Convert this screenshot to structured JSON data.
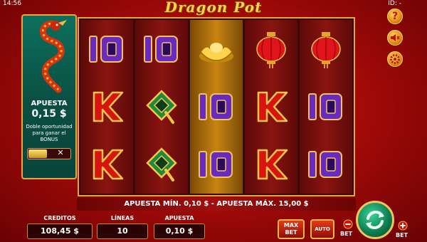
{
  "status": {
    "time": "14:56",
    "id_label": "ID: -"
  },
  "game": {
    "logo": "Dragon Pot"
  },
  "left_panel": {
    "bet_title": "APUESTA",
    "bet_value": "0,15 $",
    "note": "Doble oportunidad para ganar el BONUS",
    "toggle_off_icon": "close-x"
  },
  "reels": [
    {
      "symbols": [
        "purple-10",
        "red-K",
        "red-K"
      ]
    },
    {
      "symbols": [
        "purple-10",
        "green-Q",
        "green-Q"
      ]
    },
    {
      "symbols": [
        "gold-ingot",
        "purple-10",
        "purple-10"
      ],
      "highlighted": true
    },
    {
      "symbols": [
        "red-lantern",
        "red-K",
        "red-K"
      ]
    },
    {
      "symbols": [
        "red-lantern",
        "purple-10",
        "purple-10"
      ]
    }
  ],
  "limits_text": "APUESTA MÍN. 0,10 $ - APUESTA MÁX. 15,00 $",
  "bottom": {
    "credits_label": "CREDITOS",
    "credits_value": "108,45 $",
    "lines_label": "LÍNEAS",
    "lines_value": "10",
    "bet_label": "APUESTA",
    "bet_value": "0,10 $",
    "maxbet_line1": "MAX",
    "maxbet_line2": "BET",
    "auto_label": "AUTO",
    "bet_minus": "BET",
    "bet_plus": "BET"
  },
  "side_buttons": {
    "help": "?"
  },
  "colors": {
    "accent_gold": "#f0b64a",
    "spin_green": "#0c7a4e",
    "panel_teal": "#0d6f5c"
  }
}
